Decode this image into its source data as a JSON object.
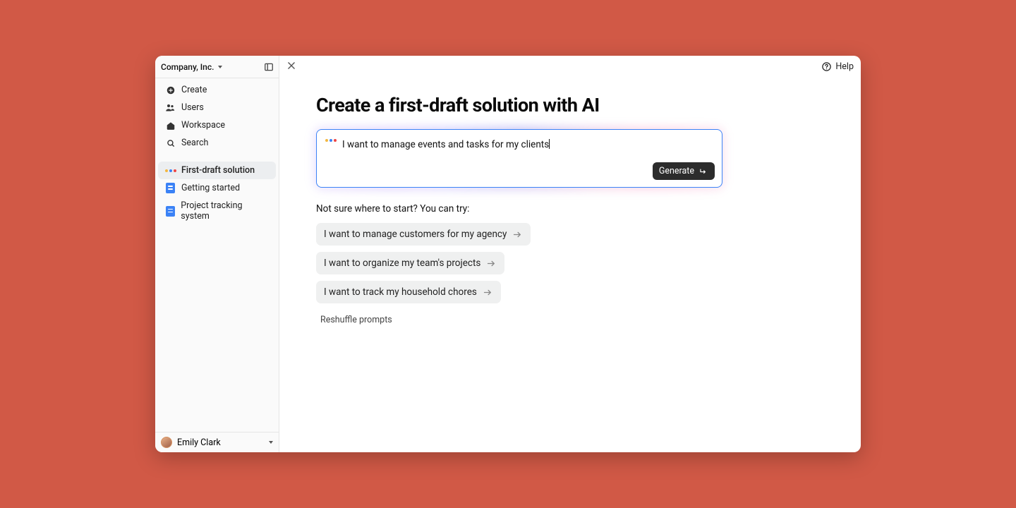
{
  "sidebar": {
    "company": "Company, Inc.",
    "nav": {
      "create": "Create",
      "users": "Users",
      "workspace": "Workspace",
      "search": "Search"
    },
    "pages": {
      "draft": "First-draft solution",
      "getting_started": "Getting started",
      "project_tracking": "Project tracking system"
    },
    "user": "Emily Clark"
  },
  "header": {
    "help": "Help"
  },
  "main": {
    "title": "Create a first-draft solution with AI",
    "prompt_value": "I want to manage events and tasks for my clients",
    "generate": "Generate",
    "hint": "Not sure where to start? You can try:",
    "suggestions": [
      "I want to manage customers for my agency",
      "I want to organize my team's projects",
      "I want to track my household chores"
    ],
    "reshuffle": "Reshuffle prompts"
  }
}
